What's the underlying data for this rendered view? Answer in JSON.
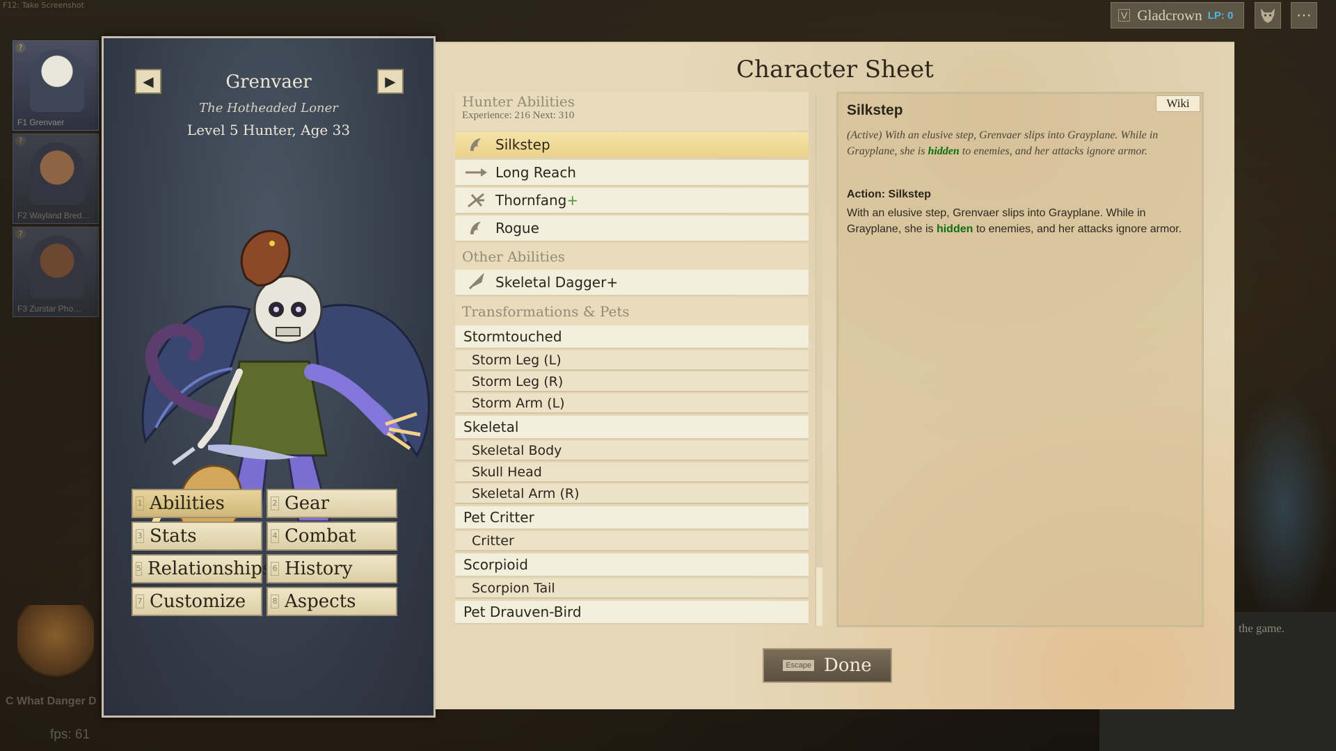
{
  "topbar": {
    "hint": "F12: Take Screenshot",
    "guild_key": "V",
    "guild_name": "Gladcrown",
    "guild_lp": "LP: 0",
    "wolf_icon": "wolf-head-icon",
    "menu_icon": "ellipsis-icon"
  },
  "party": [
    {
      "label": "F1 Grenvaer",
      "num": "?"
    },
    {
      "label": "F2 Wayland Bred…",
      "num": "?"
    },
    {
      "label": "F3 Zurstar Pho…",
      "num": "?"
    }
  ],
  "background": {
    "quest_text": "What Danger D",
    "quest_key": "C",
    "fps": "fps: 61",
    "right_text": "the game."
  },
  "character": {
    "name": "Grenvaer",
    "title": "The Hotheaded Loner",
    "level_line": "Level 5 Hunter, Age 33"
  },
  "tabs": [
    {
      "key": "1",
      "label": "Abilities",
      "active": true
    },
    {
      "key": "2",
      "label": "Gear"
    },
    {
      "key": "3",
      "label": "Stats"
    },
    {
      "key": "4",
      "label": "Combat"
    },
    {
      "key": "5",
      "label": "Relationships"
    },
    {
      "key": "6",
      "label": "History"
    },
    {
      "key": "7",
      "label": "Customize"
    },
    {
      "key": "8",
      "label": "Aspects"
    }
  ],
  "sheet": {
    "title": "Character Sheet",
    "hunter_header": "Hunter Abilities",
    "experience_line": "Experience: 216   Next: 310",
    "hunter_abilities": [
      {
        "name": "Silkstep",
        "icon": "sneak-icon"
      },
      {
        "name": "Long Reach",
        "icon": "spear-icon"
      },
      {
        "name": "Thornfang",
        "plus": "+",
        "icon": "thorn-icon"
      },
      {
        "name": "Rogue",
        "icon": "sneak-icon"
      }
    ],
    "other_header": "Other Abilities",
    "other_abilities": [
      {
        "name": "Skeletal Dagger+",
        "icon": "dagger-icon"
      }
    ],
    "transform_header": "Transformations & Pets",
    "transformations": [
      {
        "group": "Stormtouched",
        "items": [
          "Storm Leg (L)",
          "Storm Leg (R)",
          "Storm Arm (L)"
        ]
      },
      {
        "group": "Skeletal",
        "items": [
          "Skeletal Body",
          "Skull Head",
          "Skeletal Arm (R)"
        ]
      },
      {
        "group": "Pet Critter",
        "items": [
          "Critter"
        ]
      },
      {
        "group": "Scorpioid",
        "items": [
          "Scorpion Tail"
        ]
      },
      {
        "group": "Pet Drauven-Bird",
        "items": []
      }
    ],
    "detail": {
      "wiki_label": "Wiki",
      "title": "Silkstep",
      "desc_pre": "(Active) With an elusive step, Grenvaer slips into Grayplane. While in Grayplane, she is ",
      "desc_kw": "hidden",
      "desc_post": " to enemies, and her attacks ignore armor.",
      "action_label": "Action: Silkstep",
      "action_pre": "With an elusive step, Grenvaer slips into Grayplane. While in Grayplane, she is ",
      "action_kw": "hidden",
      "action_post": " to enemies, and her attacks ignore armor."
    },
    "done_key": "Escape",
    "done_label": "Done"
  }
}
